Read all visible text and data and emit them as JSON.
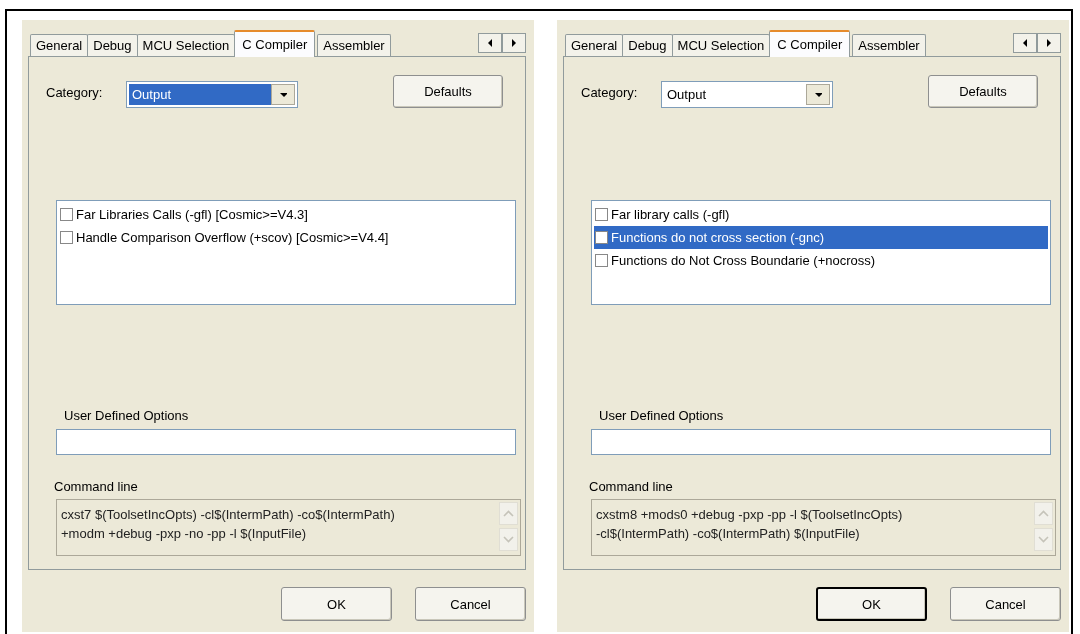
{
  "dialogs": [
    {
      "tabs": [
        {
          "label": "General",
          "selected": false
        },
        {
          "label": "Debug",
          "selected": false
        },
        {
          "label": "MCU Selection",
          "selected": false
        },
        {
          "label": "C Compiler",
          "selected": true
        },
        {
          "label": "Assembler",
          "selected": false
        }
      ],
      "category": {
        "label": "Category:",
        "value": "Output",
        "focused": true
      },
      "defaults_button": "Defaults",
      "options": [
        {
          "label": "Far Libraries Calls (-gfl) [Cosmic>=V4.3]",
          "checked": false,
          "selected": false
        },
        {
          "label": "Handle Comparison Overflow (+scov) [Cosmic>=V4.4]",
          "checked": false,
          "selected": false
        }
      ],
      "user_options": {
        "label": "User Defined Options"
      },
      "command_line": {
        "label": "Command line",
        "lines": [
          "cxst7 $(ToolsetIncOpts) -cl$(IntermPath) -co$(IntermPath)",
          "+modm +debug -pxp -no -pp -l $(InputFile)"
        ]
      },
      "buttons": [
        {
          "label": "OK",
          "default": false
        },
        {
          "label": "Cancel",
          "default": false
        }
      ]
    },
    {
      "tabs": [
        {
          "label": "General",
          "selected": false
        },
        {
          "label": "Debug",
          "selected": false
        },
        {
          "label": "MCU Selection",
          "selected": false
        },
        {
          "label": "C Compiler",
          "selected": true
        },
        {
          "label": "Assembler",
          "selected": false
        }
      ],
      "category": {
        "label": "Category:",
        "value": "Output",
        "focused": false
      },
      "defaults_button": "Defaults",
      "options": [
        {
          "label": "Far library calls (-gfl)",
          "checked": false,
          "selected": false
        },
        {
          "label": "Functions do not cross section (-gnc)",
          "checked": false,
          "selected": true
        },
        {
          "label": "Functions do Not Cross Boundarie (+nocross)",
          "checked": false,
          "selected": false
        }
      ],
      "user_options": {
        "label": "User Defined Options"
      },
      "command_line": {
        "label": "Command line",
        "lines": [
          "cxstm8 +mods0 +debug -pxp -pp -l $(ToolsetIncOpts)",
          "-cl$(IntermPath) -co$(IntermPath) $(InputFile)"
        ]
      },
      "buttons": [
        {
          "label": "OK",
          "default": true
        },
        {
          "label": "Cancel",
          "default": false
        }
      ]
    }
  ]
}
